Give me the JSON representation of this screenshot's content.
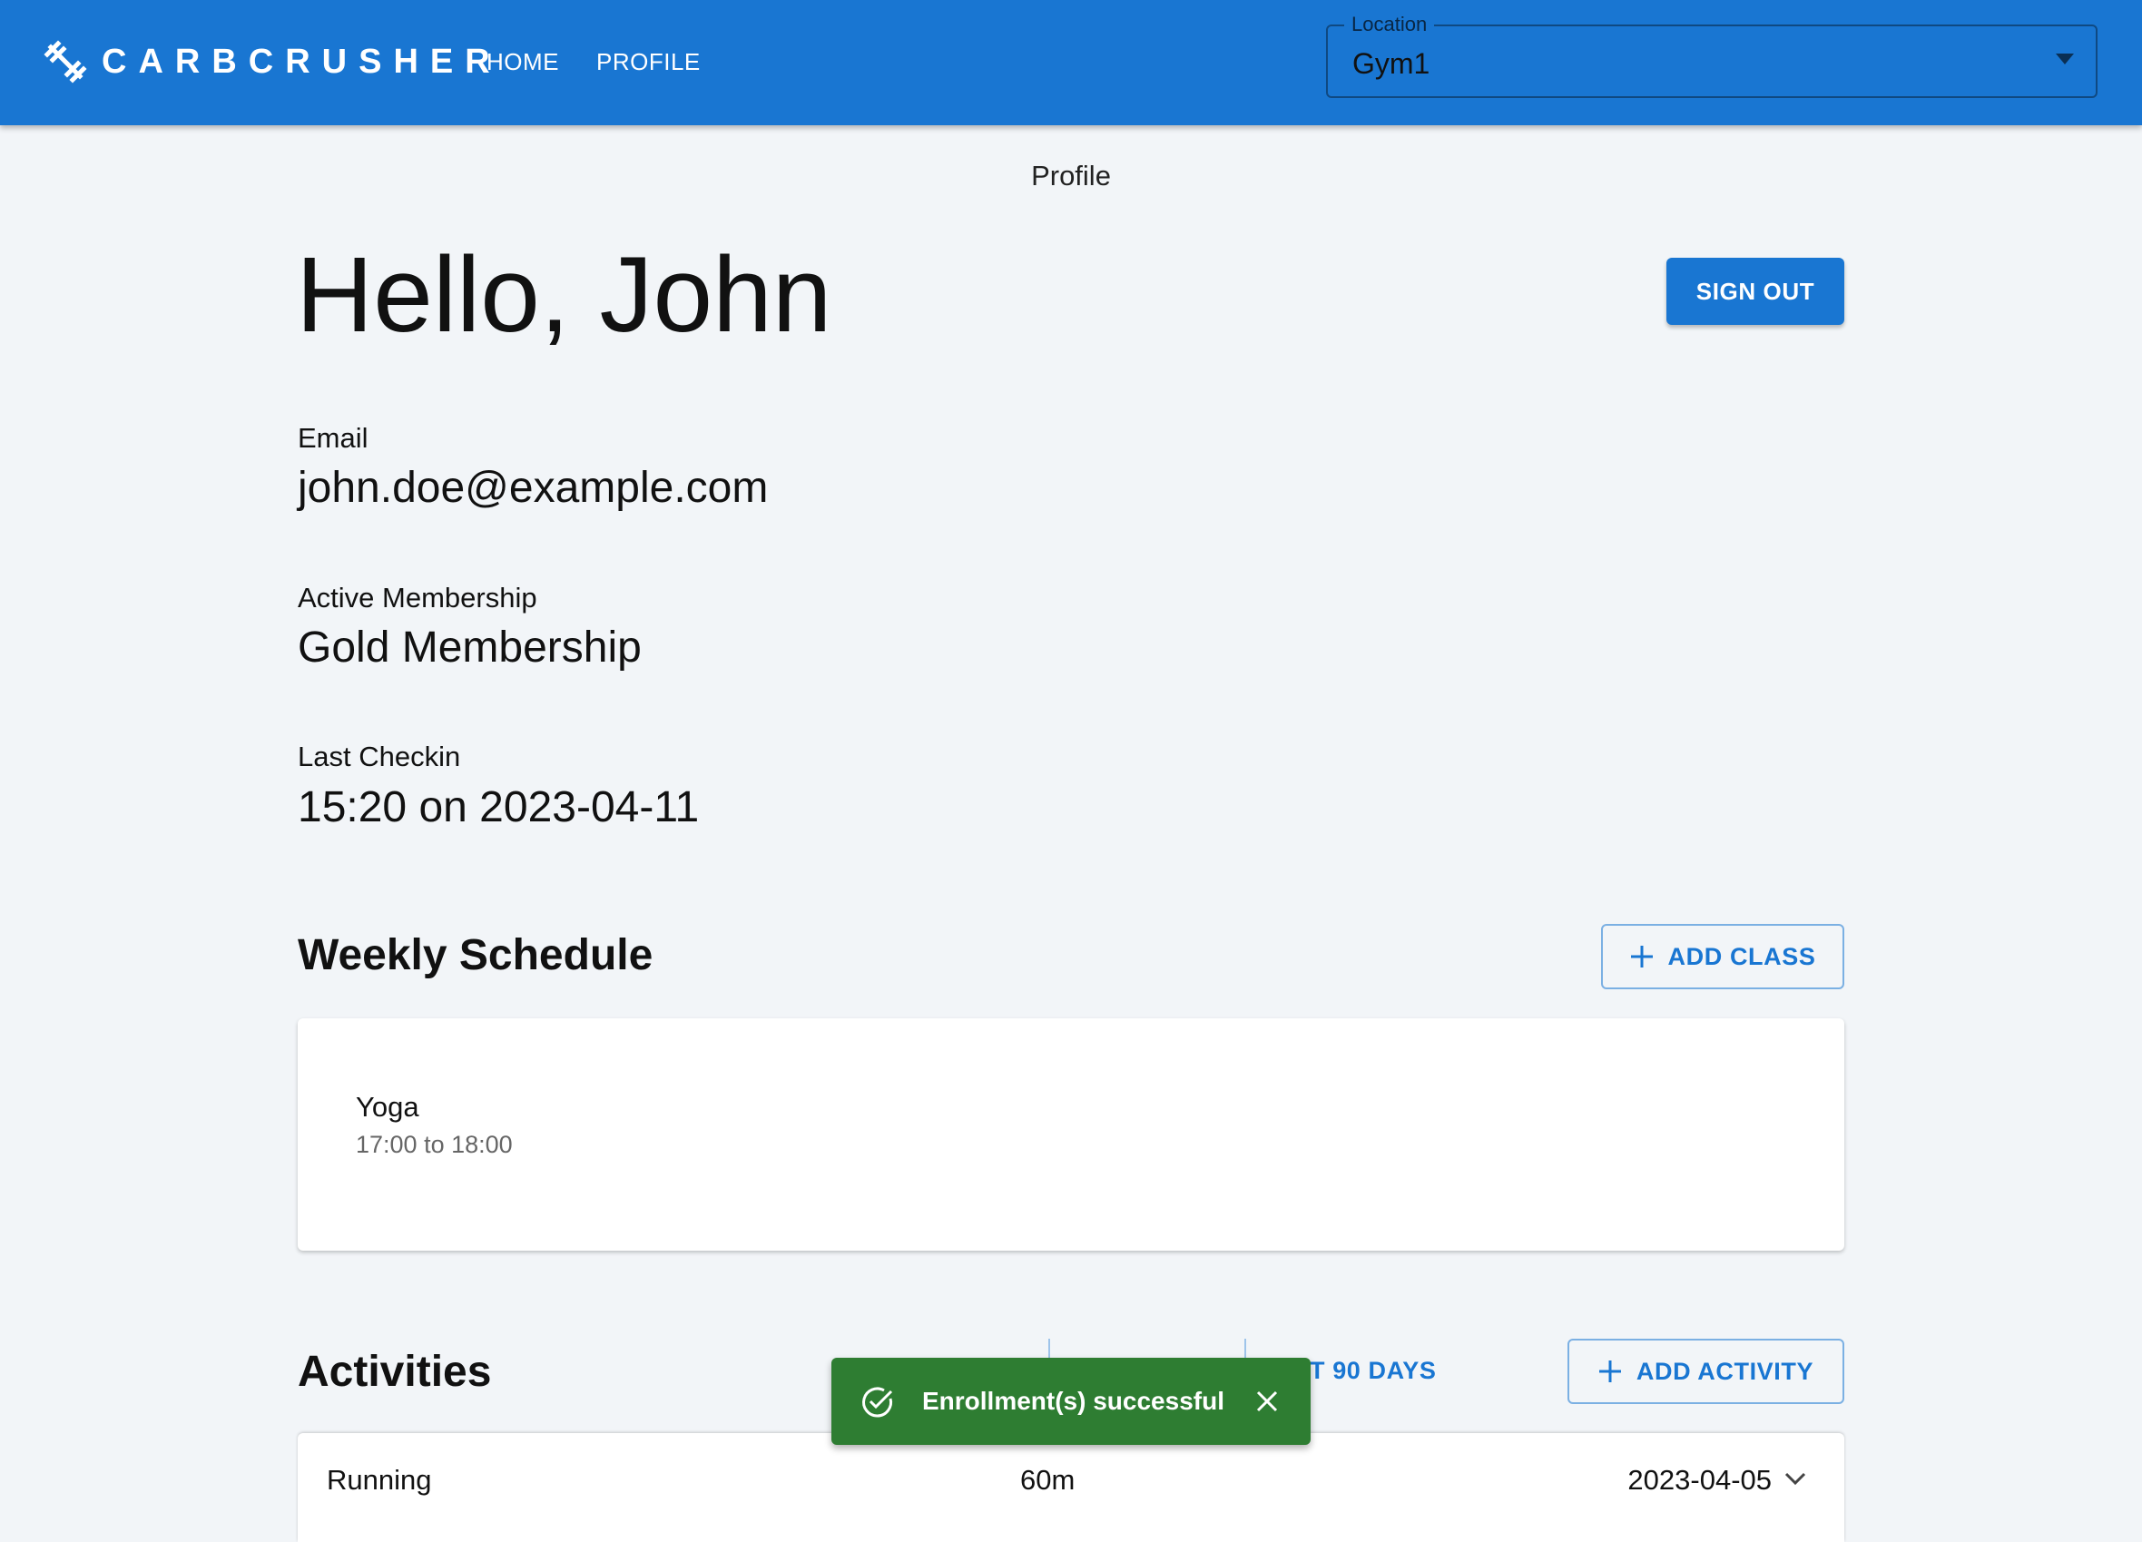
{
  "app": {
    "brand": "CARBCRUSHER",
    "logo_icon": "dumbbell-icon",
    "accent_color": "#1976d2"
  },
  "nav": {
    "home_label": "HOME",
    "profile_label": "PROFILE"
  },
  "location": {
    "label": "Location",
    "value": "Gym1"
  },
  "page": {
    "caption": "Profile",
    "greeting": "Hello, John",
    "sign_out_label": "SIGN OUT"
  },
  "profile": {
    "email_label": "Email",
    "email_value": "john.doe@example.com",
    "membership_label": "Active Membership",
    "membership_value": "Gold Membership",
    "checkin_label": "Last Checkin",
    "checkin_value": "15:20 on 2023-04-11"
  },
  "schedule": {
    "title": "Weekly Schedule",
    "add_label": "ADD CLASS",
    "classes": [
      {
        "name": "Yoga",
        "time": "17:00 to 18:00"
      }
    ]
  },
  "activities": {
    "title": "Activities",
    "partial_tab_label": "T 90 DAYS",
    "add_label": "ADD ACTIVITY",
    "items": [
      {
        "name": "Running",
        "duration": "60m",
        "date": "2023-04-05"
      }
    ]
  },
  "snackbar": {
    "message": "Enrollment(s) successful",
    "status_color": "#2e7d32",
    "icon": "check-circle-icon"
  }
}
